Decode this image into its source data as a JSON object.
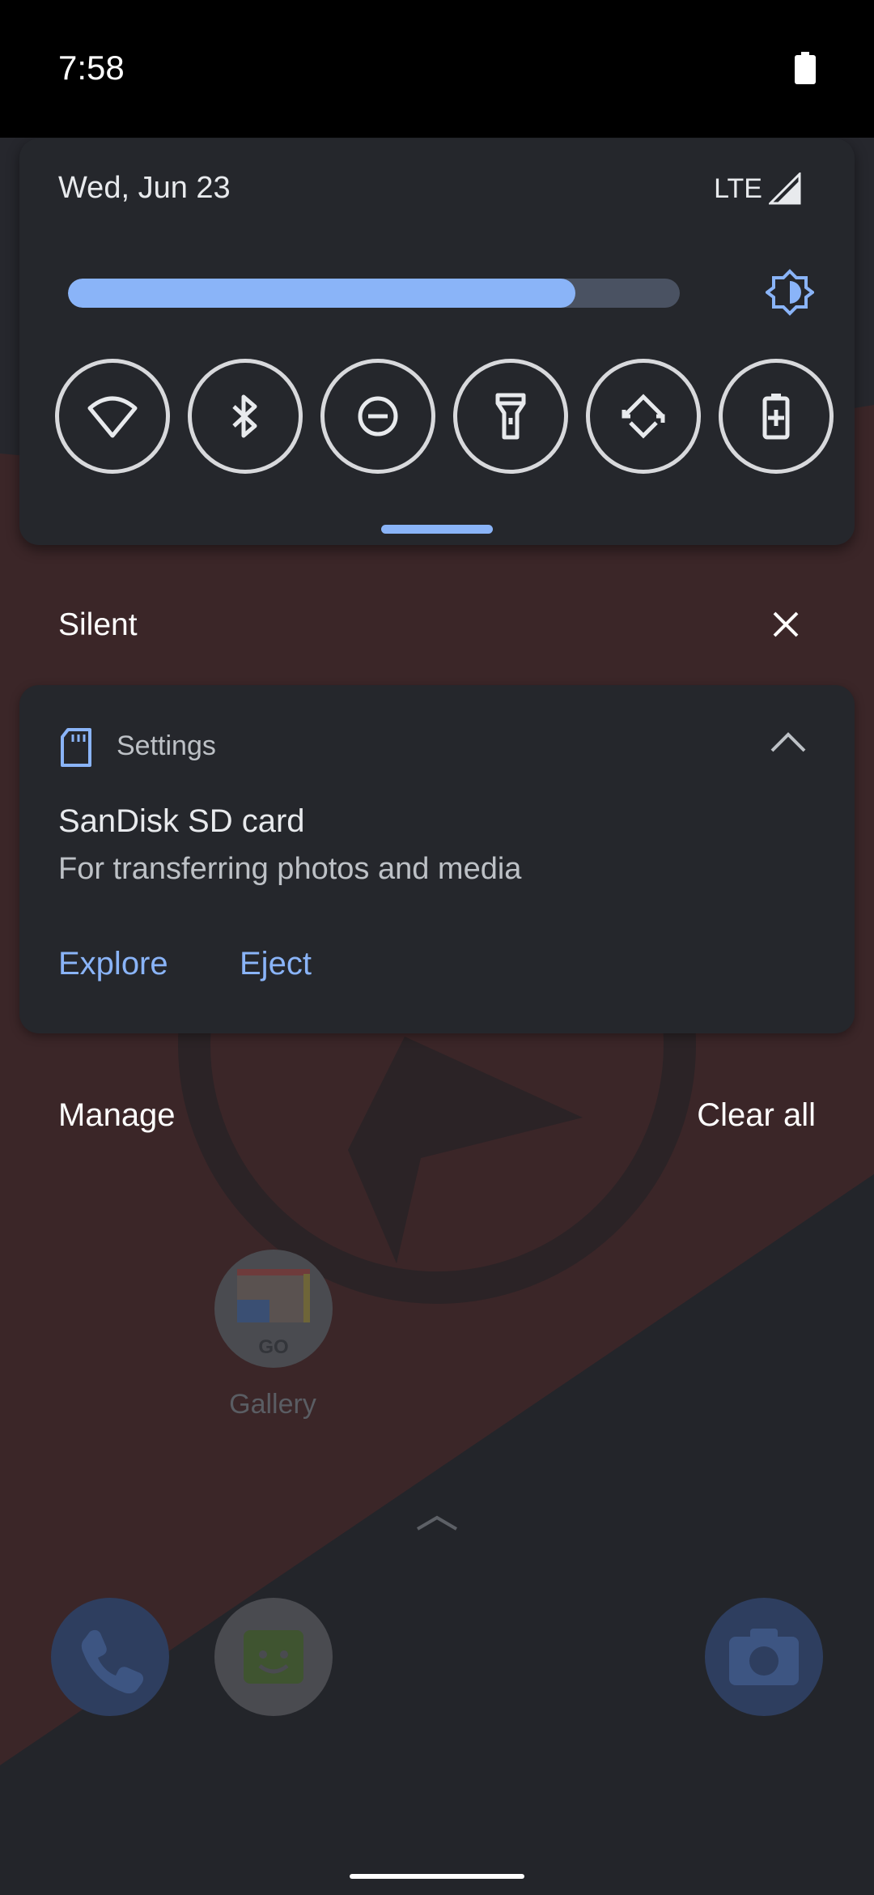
{
  "status_bar": {
    "time": "7:58",
    "battery_icon": "battery-icon"
  },
  "quick_settings": {
    "date": "Wed, Jun 23",
    "network_label": "LTE",
    "brightness_level": 0.83,
    "tiles": [
      {
        "name": "wifi",
        "icon": "wifi-icon"
      },
      {
        "name": "bluetooth",
        "icon": "bluetooth-icon"
      },
      {
        "name": "do-not-disturb",
        "icon": "do-not-disturb-icon"
      },
      {
        "name": "flashlight",
        "icon": "flashlight-icon"
      },
      {
        "name": "auto-rotate",
        "icon": "auto-rotate-icon"
      },
      {
        "name": "battery-saver",
        "icon": "battery-saver-icon"
      }
    ]
  },
  "silent_section": {
    "label": "Silent"
  },
  "notification": {
    "app_name": "Settings",
    "title": "SanDisk SD card",
    "text": "For transferring photos and media",
    "actions": {
      "explore": "Explore",
      "eject": "Eject"
    }
  },
  "footer": {
    "manage": "Manage",
    "clear_all": "Clear all"
  },
  "home": {
    "gallery_label": "Gallery",
    "gallery_badge": "GO"
  },
  "colors": {
    "accent": "#8ab4f8",
    "panel": "#25272c",
    "wallpaper_red": "#5a2a2c"
  }
}
